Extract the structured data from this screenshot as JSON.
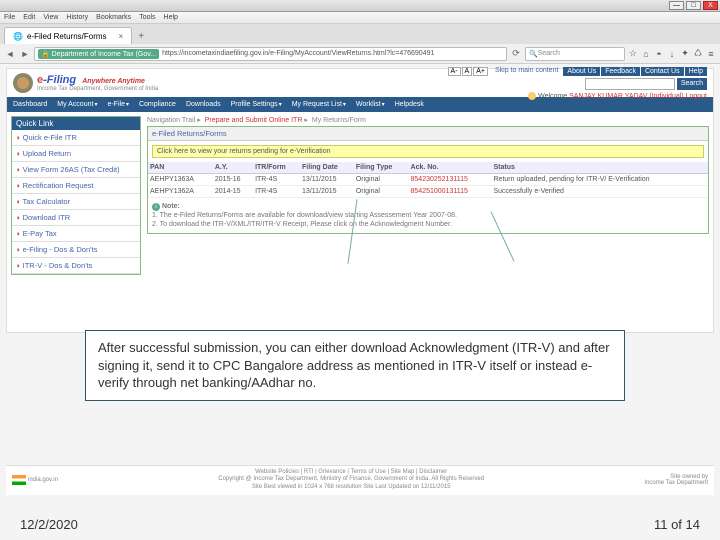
{
  "menubar": [
    "File",
    "Edit",
    "View",
    "History",
    "Bookmarks",
    "Tools",
    "Help"
  ],
  "tab": {
    "title": "e-Filed Returns/Forms"
  },
  "url": {
    "secure": "Department of Income Tax (Gov...",
    "path": "https://incometaxindiaefiling.gov.in/e-Filing/MyAccount/ViewReturns.html?lc=476690491"
  },
  "search_placeholder": "Search",
  "brand": {
    "name": "e-Filing",
    "tag": "Anywhere Anytime",
    "sub": "Income Tax Department, Government of India"
  },
  "fontsize": [
    "A-",
    "A",
    "A+"
  ],
  "skip": "Skip to main content",
  "headerbtns": [
    "About Us",
    "Feedback",
    "Contact Us",
    "Help"
  ],
  "search_btn": "Search",
  "welcome": {
    "pre": "Welcome",
    "name": "SANJAY KUMAR YADAV (Individual)",
    "logout": "Logout"
  },
  "nav": [
    "Dashboard",
    "My Account",
    "e-File",
    "Compliance",
    "Downloads",
    "Profile Settings",
    "My Request List",
    "Worklist",
    "Helpdesk"
  ],
  "quicklink": {
    "title": "Quick Link",
    "items": [
      "Quick e-File ITR",
      "Upload Return",
      "View Form 26AS (Tax Credit)",
      "Rectification Request",
      "Tax Calculator",
      "Download ITR",
      "E-Pay Tax",
      "e-Filing - Dos & Don'ts",
      "ITR-V - Dos & Don'ts"
    ]
  },
  "bc": {
    "a": "Navigation Trail",
    "b": "Prepare and Submit Online ITR",
    "c": "My Returns/Form"
  },
  "section_title": "e-Filed Returns/Forms",
  "verify_btn": "Click here to view your returns pending for e-Verification",
  "table": {
    "headers": [
      "PAN",
      "A.Y.",
      "ITR/Form",
      "Filing Date",
      "Filing Type",
      "Ack. No.",
      "Status"
    ],
    "rows": [
      [
        "AEHPY1363A",
        "2015-16",
        "ITR-4S",
        "13/11/2015",
        "Original",
        "854230252131115",
        "Return uploaded, pending for ITR-V/ E-Verification"
      ],
      [
        "AEHPY1362A",
        "2014-15",
        "ITR-4S",
        "13/11/2015",
        "Original",
        "854251000131115",
        "Successfully e-Verified"
      ]
    ]
  },
  "note": {
    "title": "Note:",
    "l1": "1. The e-Filed Returns/Forms are available for download/view starting Assessement Year 2007-08.",
    "l2": "2. To download the ITR-V/XML/ITR/ITR-V Receipt, Please click on the Acknowledgment Number."
  },
  "footer": {
    "india": "india.gov.in",
    "mid1": "Website Policies | RTI | Grievance | Terms of Use | Site Map | Disclaimer",
    "mid2": "Copyright @ Income Tax Department, Ministry of Finance, Government of India. All Rights Reserved",
    "mid3": "Site Best viewed in 1024 x 768 resolution Site Last Updated on 12/11/2015",
    "right1": "Site owned by",
    "right2": "Income Tax Department"
  },
  "callout": "After successful submission, you can either download Acknowledgment (ITR-V) and after signing it, send it to CPC Bangalore address as mentioned in ITR-V itself or instead e-verify through net banking/AAdhar no.",
  "date": "12/2/2020",
  "pagenum": "11 of 14"
}
